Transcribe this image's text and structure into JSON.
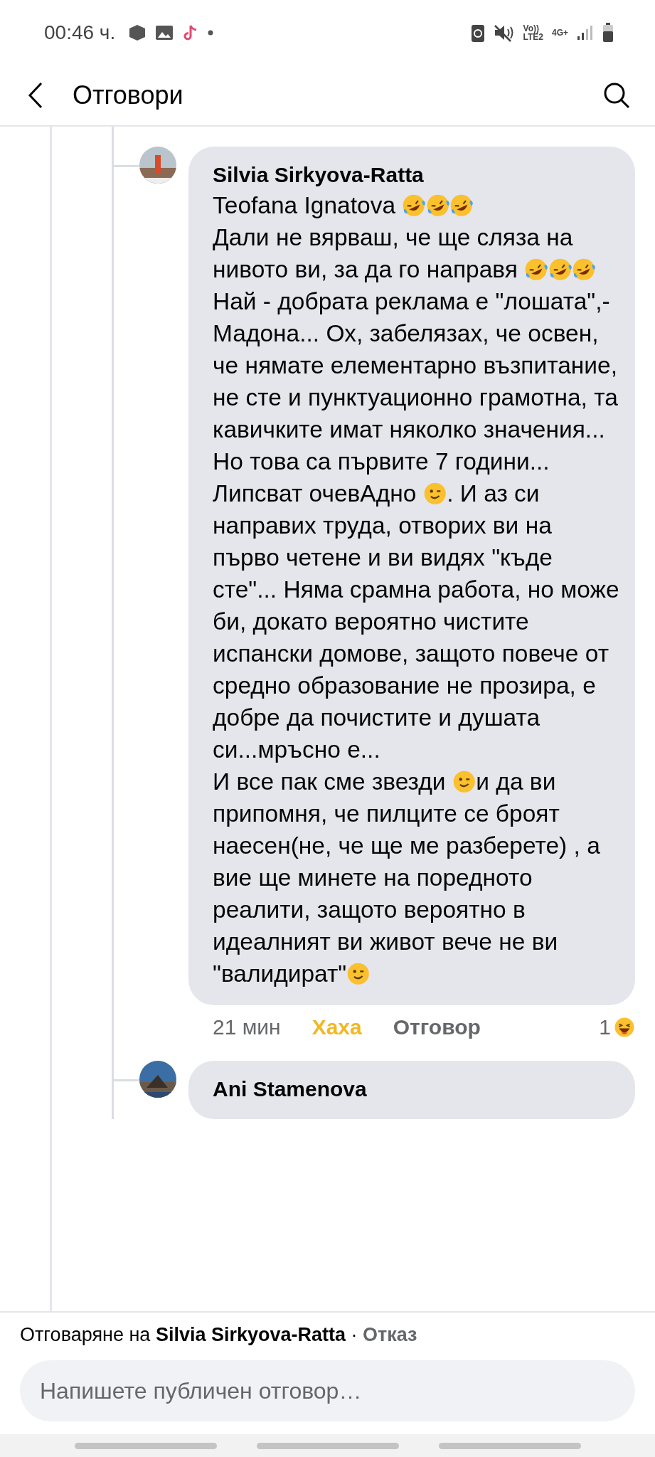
{
  "status_bar": {
    "time": "00:46 ч.",
    "volte": "Vo))",
    "lte": "LTE2",
    "network_type": "4G+"
  },
  "header": {
    "title": "Отговори"
  },
  "comments": [
    {
      "author": "Silvia Sirkyova-Ratta",
      "paragraphs": [
        [
          {
            "kind": "text",
            "text": "Teofana Ignatova "
          },
          {
            "kind": "rofl"
          },
          {
            "kind": "rofl"
          },
          {
            "kind": "rofl"
          }
        ],
        [
          {
            "kind": "text",
            "text": "Дали не вярваш, че ще сляза на нивото ви, за да го направя "
          },
          {
            "kind": "rofl"
          },
          {
            "kind": "rofl"
          },
          {
            "kind": "rofl"
          },
          {
            "kind": "text",
            "text": "Най - добрата реклама е \"лошата\",-Мадона... Ох, забелязах, че освен, че нямате елементарно възпитание, не сте и пунктуационно грамотна, та кавичките имат няколко значения... Но това са първите 7 години... Липсват очевАдно "
          },
          {
            "kind": "wink"
          },
          {
            "kind": "text",
            "text": ". И аз си направих труда, отворих ви на първо четене и ви видях \"къде сте\"... Няма срамна работа, но може би, докато вероятно чистите испански домове, защото повече от средно образование не прозира, е добре да почистите и душата си...мръсно е..."
          }
        ],
        [
          {
            "kind": "text",
            "text": "И все пак сме звезди "
          },
          {
            "kind": "wink"
          },
          {
            "kind": "text",
            "text": "и да ви припомня, че пилците се броят наесен(не, че ще ме разберете) , а вие ще минете на поредното реалити, защото вероятно в идеалният ви живот вече не ви \"валидират\""
          },
          {
            "kind": "wink"
          }
        ]
      ],
      "time": "21 мин",
      "reaction": {
        "label": "Хаха",
        "active": true
      },
      "reply": "Отговор",
      "reaction_count": "1"
    },
    {
      "author": "Ani Stamenova"
    }
  ],
  "reply_bar": {
    "text": "Отговаряне на **Silvia Sirkyova-Ratta** · ",
    "cancel": "Отказ"
  },
  "composer": {
    "placeholder": "Напишете публичен отговор…"
  }
}
